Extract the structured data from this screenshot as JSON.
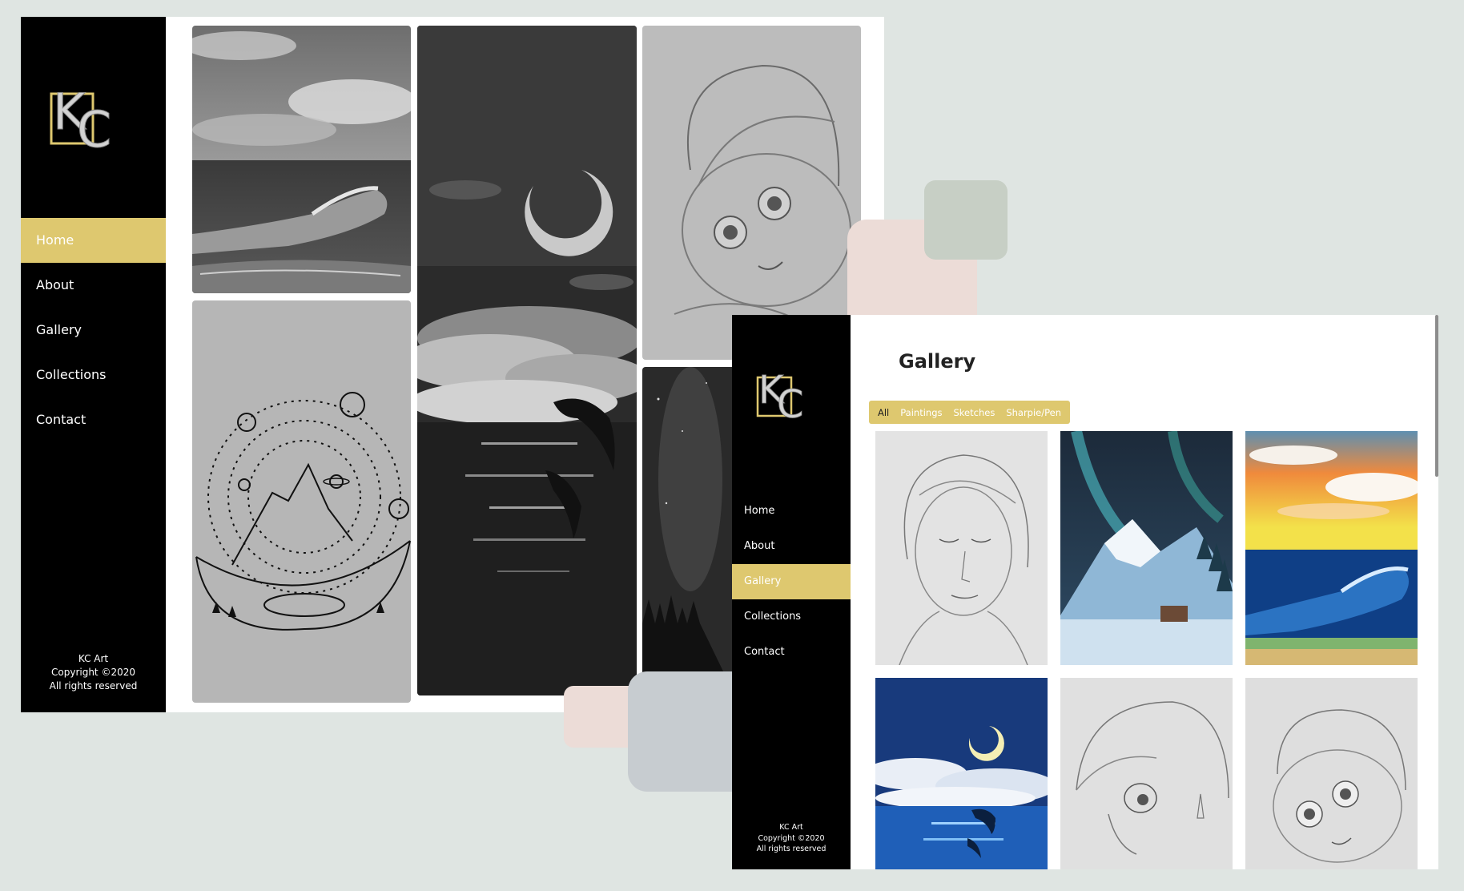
{
  "home_window": {
    "brand": "KC",
    "nav": [
      {
        "label": "Home",
        "active": true
      },
      {
        "label": "About",
        "active": false
      },
      {
        "label": "Gallery",
        "active": false
      },
      {
        "label": "Collections",
        "active": false
      },
      {
        "label": "Contact",
        "active": false
      }
    ],
    "footer": {
      "line1": "KC Art",
      "line2": "Copyright ©2020",
      "line3": "All rights reserved"
    },
    "artworks": [
      "ocean-wave-painting",
      "moon-dolphins-painting",
      "girl-portrait-sketch",
      "solar-system-ink-drawing",
      "night-sky-painting"
    ]
  },
  "gallery_window": {
    "brand": "KC",
    "title": "Gallery",
    "filters": [
      {
        "label": "All",
        "active": true
      },
      {
        "label": "Paintings",
        "active": false
      },
      {
        "label": "Sketches",
        "active": false
      },
      {
        "label": "Sharpie/Pen",
        "active": false
      }
    ],
    "nav": [
      {
        "label": "Home",
        "active": false
      },
      {
        "label": "About",
        "active": false
      },
      {
        "label": "Gallery",
        "active": true
      },
      {
        "label": "Collections",
        "active": false
      },
      {
        "label": "Contact",
        "active": false
      }
    ],
    "footer": {
      "line1": "KC Art",
      "line2": "Copyright ©2020",
      "line3": "All rights reserved"
    },
    "thumbnails": [
      "girl-face-sketch",
      "aurora-mountain-painting",
      "sunset-wave-painting",
      "moon-dolphin-painting",
      "mermaid-sketch",
      "girl-portrait-sketch"
    ]
  },
  "colors": {
    "accent": "#dec86f",
    "sidebar": "#000000",
    "background": "#dfe5e2",
    "swatch_pink": "#ecdcd7",
    "swatch_sage": "#c7cfc5",
    "swatch_blue": "#c7ccd0"
  }
}
